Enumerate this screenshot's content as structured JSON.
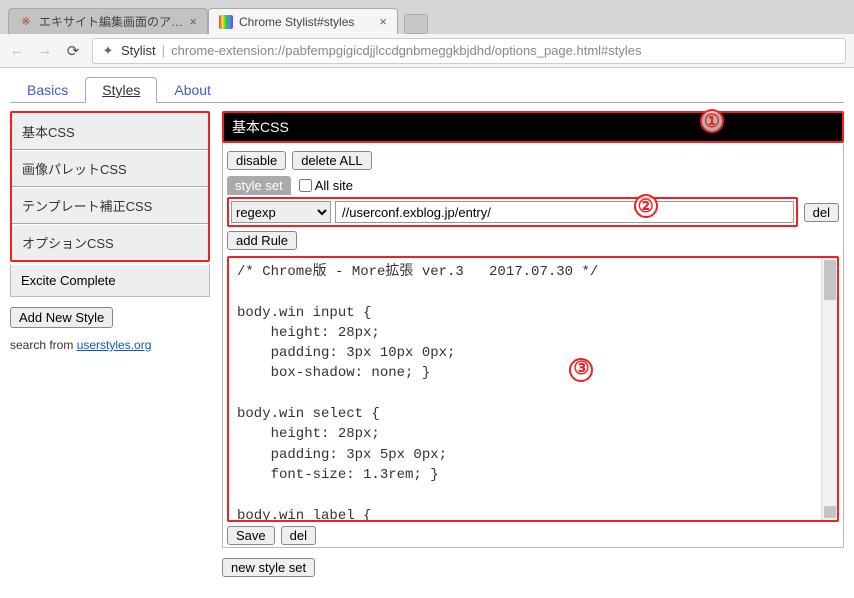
{
  "browser": {
    "tabs": [
      {
        "title": "エキサイト編集画面のアレン",
        "favicon": "※",
        "active": false
      },
      {
        "title": "Chrome Stylist#styles",
        "favicon": "▮",
        "active": true
      }
    ],
    "url_title": "Stylist",
    "url_rest": "chrome-extension://pabfempgigicdjjlccdgnbmeggkbjdhd/options_page.html#styles"
  },
  "topTabs": {
    "items": [
      "Basics",
      "Styles",
      "About"
    ],
    "activeIndex": 1
  },
  "sidebar": {
    "styles": [
      "基本CSS",
      "画像パレットCSS",
      "テンプレート補正CSS",
      "オプションCSS"
    ],
    "extra": "Excite Complete",
    "add_label": "Add New Style",
    "search_prefix": "search from ",
    "search_link": "userstyles.org"
  },
  "editor": {
    "title": "基本CSS",
    "disable_label": "disable",
    "delete_all_label": "delete ALL",
    "style_set_label": "style set",
    "all_site_label": "All site",
    "rule_type": "regexp",
    "rule_value": "//userconf.exblog.jp/entry/",
    "del_label": "del",
    "add_rule_label": "add Rule",
    "code": "/* Chrome版 - More拡張 ver.3   2017.07.30 */\n\nbody.win input {\n    height: 28px;\n    padding: 3px 10px 0px;\n    box-shadow: none; }\n\nbody.win select {\n    height: 28px;\n    padding: 3px 5px 0px;\n    font-size: 1.3rem; }\n\nbody.win label {",
    "save_label": "Save",
    "del2_label": "del",
    "new_style_set_label": "new style set"
  },
  "annotations": {
    "a1": "①",
    "a2": "②",
    "a3": "③"
  }
}
